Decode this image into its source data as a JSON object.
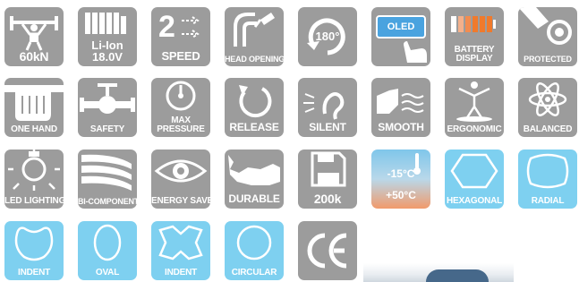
{
  "tiles": {
    "t60kn": {
      "label": "60kN"
    },
    "liion": {
      "line1": "Li-Ion",
      "line2": "18.0V"
    },
    "speed": {
      "label": "SPEED",
      "digit": "2"
    },
    "head_opening": {
      "label": "HEAD OPENING"
    },
    "rot180": {
      "value": "180°"
    },
    "oled": {
      "screen": "OLED"
    },
    "battery_display": {
      "label": "BATTERY\nDISPLAY"
    },
    "protected": {
      "label": "PROTECTED"
    },
    "one_hand": {
      "label": "ONE HAND"
    },
    "safety": {
      "label": "SAFETY"
    },
    "max_pressure": {
      "label": "MAX\nPRESSURE"
    },
    "release": {
      "label": "RELEASE"
    },
    "silent": {
      "label": "SILENT"
    },
    "smooth": {
      "label": "SMOOTH"
    },
    "ergonomic": {
      "label": "ERGONOMIC"
    },
    "balanced": {
      "label": "BALANCED"
    },
    "led_lighting": {
      "label": "LED LIGHTING"
    },
    "bi_component": {
      "label": "BI-COMPONENT"
    },
    "energy_save": {
      "label": "ENERGY SAVE"
    },
    "durable": {
      "label": "DURABLE"
    },
    "t200k": {
      "label": "200k"
    },
    "temperature": {
      "low": "-15°C",
      "high": "+50°C"
    },
    "hexagonal": {
      "label": "HEXAGONAL"
    },
    "radial": {
      "label": "RADIAL"
    },
    "indent1": {
      "label": "INDENT"
    },
    "oval": {
      "label": "OVAL"
    },
    "indent2": {
      "label": "INDENT"
    },
    "circular": {
      "label": "CIRCULAR"
    },
    "ce": {
      "mark": "CE"
    }
  },
  "colors": {
    "gray_tile": "#9c9c9c",
    "blue_tile": "#7ed0f0",
    "oled_screen": "#4aa3df",
    "battery_orange": "#f07a2c"
  },
  "icons": [
    "weightlifter-icon",
    "battery-pack-icon",
    "speed-arrows-icon",
    "crimp-head-icon",
    "rotate-180-icon",
    "oled-screen-icon",
    "battery-level-icon",
    "protected-icon",
    "hand-grip-icon",
    "valve-icon",
    "pressure-gauge-icon",
    "release-arrow-icon",
    "ear-icon",
    "smooth-hand-icon",
    "ergonomic-figure-icon",
    "atom-icon",
    "light-bulb-icon",
    "bi-component-icon",
    "eye-icon",
    "rhino-icon",
    "floppy-disk-icon",
    "thermometer-icon",
    "hexagon-icon",
    "rounded-rect-icon",
    "indent-die-icon",
    "oval-icon",
    "indent-diamond-icon",
    "circle-icon",
    "ce-mark-icon"
  ]
}
